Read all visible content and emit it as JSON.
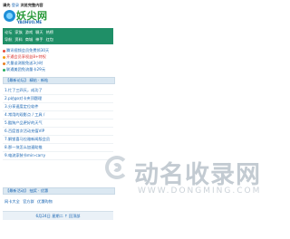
{
  "topbar": {
    "login": "请先",
    "register": "登录",
    "tagline": "浏览完整内容"
  },
  "logo": {
    "title": "妖尖网",
    "subtitle": "YAOHUO.ME"
  },
  "nav": {
    "row1": [
      "论坛",
      "家族",
      "游戏",
      "聊天",
      "热榜"
    ],
    "row2": [
      "导航",
      "资料",
      "商城",
      "神手",
      "红包"
    ]
  },
  "news": [
    {
      "text": "腾讯视频会员免费领30天",
      "dot_color": "#e74c3c"
    },
    {
      "text": "开通会员享权益8+特权",
      "dot_color": "#f39c12",
      "red": true
    },
    {
      "text": "大量谈测限免送3小时",
      "dot_color": "#e67e22"
    },
    {
      "text": "联通美团免流量卡29元",
      "dot_color": "#27ae60"
    }
  ],
  "section1": {
    "title": "【最新论坛】 精帖 · 新帖"
  },
  "list": [
    "1.忙了三四天，成功了",
    "2.p站go对卡夹顶题理",
    "3.分享速度定位软件",
    "4.常用的观影点 / 工具 /",
    "5.酷狗产品更好的天气",
    "6.百度首次活动充值VIP",
    "7.解锁喜马拉雅新闻版会员",
    "8.那一块怎么加速助推",
    "9.电流家装节min-carry"
  ],
  "section2": {
    "title": "【最新活动】 抽奖 · 优惠"
  },
  "links": [
    "网卡大全",
    "官方群",
    "优惠购物"
  ],
  "footer": {
    "text": "6月24日 星期二 ↑ 回顶部"
  },
  "watermark": {
    "text": "动名收录网",
    "url": "WWW.DONGMING.COM"
  },
  "colors": {
    "nav_green": "#1f8f67",
    "link_blue": "#1a66b3",
    "section_bg": "#dbe8f2"
  }
}
